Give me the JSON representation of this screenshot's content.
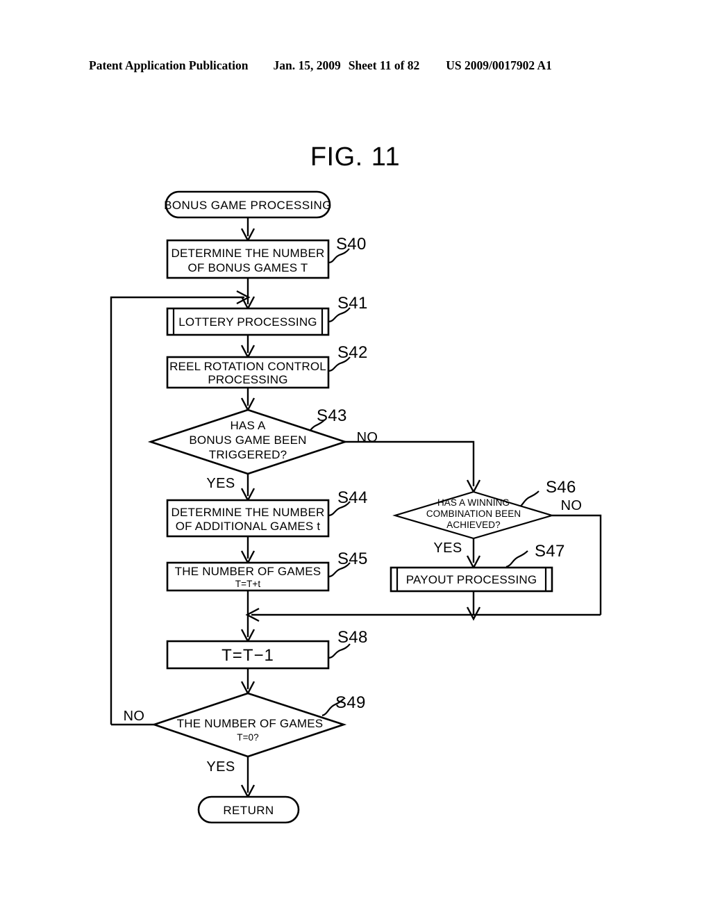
{
  "header": {
    "publication": "Patent Application Publication",
    "date": "Jan. 15, 2009",
    "sheet": "Sheet 11 of 82",
    "patent_number": "US 2009/0017902 A1"
  },
  "figure": {
    "label_word": "FIG.",
    "label_number": "11"
  },
  "flowchart": {
    "nodes": {
      "start": {
        "text": "BONUS GAME PROCESSING",
        "shape": "terminator"
      },
      "s40": {
        "step": "S40",
        "line1": "DETERMINE THE NUMBER",
        "line2": "OF BONUS GAMES T",
        "shape": "process"
      },
      "s41": {
        "step": "S41",
        "line1": "LOTTERY PROCESSING",
        "shape": "predefined-process"
      },
      "s42": {
        "step": "S42",
        "line1": "REEL ROTATION CONTROL",
        "line2": "PROCESSING",
        "shape": "process"
      },
      "s43": {
        "step": "S43",
        "line1": "HAS A",
        "line2": "BONUS GAME BEEN",
        "line3": "TRIGGERED?",
        "shape": "decision",
        "yes": "YES",
        "no": "NO"
      },
      "s44": {
        "step": "S44",
        "line1": "DETERMINE THE NUMBER",
        "line2": "OF ADDITIONAL GAMES t",
        "shape": "process"
      },
      "s45": {
        "step": "S45",
        "line1": "THE NUMBER OF GAMES",
        "line2": "T=T+t",
        "shape": "process"
      },
      "s46": {
        "step": "S46",
        "line1": "HAS A WINNING",
        "line2": "COMBINATION BEEN",
        "line3": "ACHIEVED?",
        "shape": "decision",
        "yes": "YES",
        "no": "NO"
      },
      "s47": {
        "step": "S47",
        "line1": "PAYOUT PROCESSING",
        "shape": "predefined-process"
      },
      "s48": {
        "step": "S48",
        "line1": "T=T−1",
        "shape": "process"
      },
      "s49": {
        "step": "S49",
        "line1": "THE NUMBER OF GAMES",
        "line2": "T=0?",
        "shape": "decision",
        "yes": "YES",
        "no": "NO"
      },
      "end": {
        "text": "RETURN",
        "shape": "terminator"
      }
    }
  }
}
